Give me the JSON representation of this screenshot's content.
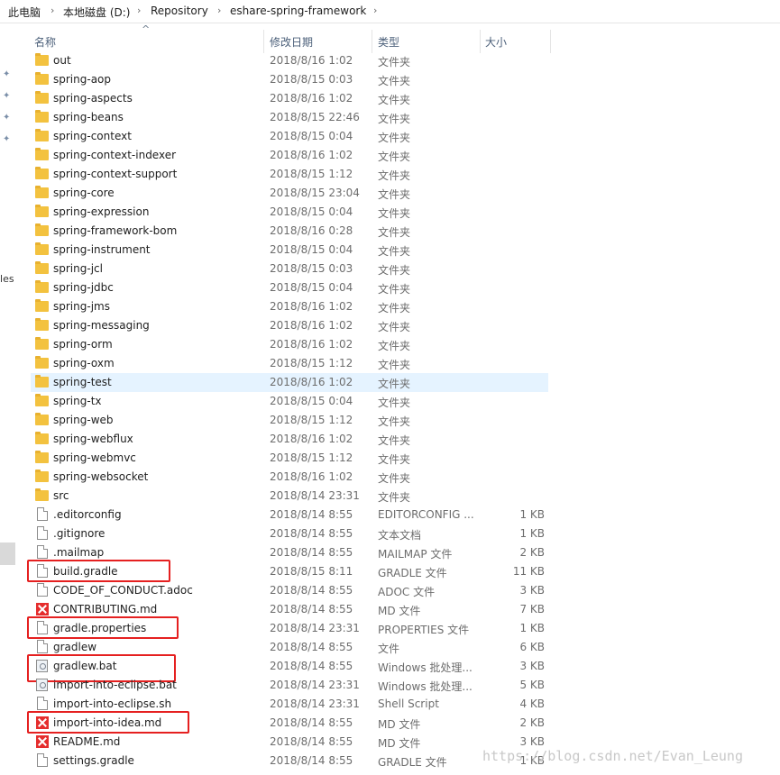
{
  "breadcrumb": [
    "此电脑",
    "本地磁盘 (D:)",
    "Repository",
    "eshare-spring-framework"
  ],
  "nav": {
    "files_label": "iles"
  },
  "columns": {
    "name": "名称",
    "date": "修改日期",
    "type": "类型",
    "size": "大小"
  },
  "files": [
    {
      "name": "out",
      "date": "2018/8/16 1:02",
      "type": "文件夹",
      "size": "",
      "icon": "folder-icon"
    },
    {
      "name": "spring-aop",
      "date": "2018/8/15 0:03",
      "type": "文件夹",
      "size": "",
      "icon": "folder-icon"
    },
    {
      "name": "spring-aspects",
      "date": "2018/8/16 1:02",
      "type": "文件夹",
      "size": "",
      "icon": "folder-icon"
    },
    {
      "name": "spring-beans",
      "date": "2018/8/15 22:46",
      "type": "文件夹",
      "size": "",
      "icon": "folder-icon"
    },
    {
      "name": "spring-context",
      "date": "2018/8/15 0:04",
      "type": "文件夹",
      "size": "",
      "icon": "folder-icon"
    },
    {
      "name": "spring-context-indexer",
      "date": "2018/8/16 1:02",
      "type": "文件夹",
      "size": "",
      "icon": "folder-icon"
    },
    {
      "name": "spring-context-support",
      "date": "2018/8/15 1:12",
      "type": "文件夹",
      "size": "",
      "icon": "folder-icon"
    },
    {
      "name": "spring-core",
      "date": "2018/8/15 23:04",
      "type": "文件夹",
      "size": "",
      "icon": "folder-icon"
    },
    {
      "name": "spring-expression",
      "date": "2018/8/15 0:04",
      "type": "文件夹",
      "size": "",
      "icon": "folder-icon"
    },
    {
      "name": "spring-framework-bom",
      "date": "2018/8/16 0:28",
      "type": "文件夹",
      "size": "",
      "icon": "folder-icon"
    },
    {
      "name": "spring-instrument",
      "date": "2018/8/15 0:04",
      "type": "文件夹",
      "size": "",
      "icon": "folder-icon"
    },
    {
      "name": "spring-jcl",
      "date": "2018/8/15 0:03",
      "type": "文件夹",
      "size": "",
      "icon": "folder-icon"
    },
    {
      "name": "spring-jdbc",
      "date": "2018/8/15 0:04",
      "type": "文件夹",
      "size": "",
      "icon": "folder-icon"
    },
    {
      "name": "spring-jms",
      "date": "2018/8/16 1:02",
      "type": "文件夹",
      "size": "",
      "icon": "folder-icon"
    },
    {
      "name": "spring-messaging",
      "date": "2018/8/16 1:02",
      "type": "文件夹",
      "size": "",
      "icon": "folder-icon"
    },
    {
      "name": "spring-orm",
      "date": "2018/8/16 1:02",
      "type": "文件夹",
      "size": "",
      "icon": "folder-icon"
    },
    {
      "name": "spring-oxm",
      "date": "2018/8/15 1:12",
      "type": "文件夹",
      "size": "",
      "icon": "folder-icon"
    },
    {
      "name": "spring-test",
      "date": "2018/8/16 1:02",
      "type": "文件夹",
      "size": "",
      "icon": "folder-icon",
      "selected": true
    },
    {
      "name": "spring-tx",
      "date": "2018/8/15 0:04",
      "type": "文件夹",
      "size": "",
      "icon": "folder-icon"
    },
    {
      "name": "spring-web",
      "date": "2018/8/15 1:12",
      "type": "文件夹",
      "size": "",
      "icon": "folder-icon"
    },
    {
      "name": "spring-webflux",
      "date": "2018/8/16 1:02",
      "type": "文件夹",
      "size": "",
      "icon": "folder-icon"
    },
    {
      "name": "spring-webmvc",
      "date": "2018/8/15 1:12",
      "type": "文件夹",
      "size": "",
      "icon": "folder-icon"
    },
    {
      "name": "spring-websocket",
      "date": "2018/8/16 1:02",
      "type": "文件夹",
      "size": "",
      "icon": "folder-icon"
    },
    {
      "name": "src",
      "date": "2018/8/14 23:31",
      "type": "文件夹",
      "size": "",
      "icon": "folder-icon"
    },
    {
      "name": ".editorconfig",
      "date": "2018/8/14 8:55",
      "type": "EDITORCONFIG ...",
      "size": "1 KB",
      "icon": "file-icon"
    },
    {
      "name": ".gitignore",
      "date": "2018/8/14 8:55",
      "type": "文本文档",
      "size": "1 KB",
      "icon": "file-icon"
    },
    {
      "name": ".mailmap",
      "date": "2018/8/14 8:55",
      "type": "MAILMAP 文件",
      "size": "2 KB",
      "icon": "file-icon"
    },
    {
      "name": "build.gradle",
      "date": "2018/8/15 8:11",
      "type": "GRADLE 文件",
      "size": "11 KB",
      "icon": "file-icon",
      "highlighted": true
    },
    {
      "name": "CODE_OF_CONDUCT.adoc",
      "date": "2018/8/14 8:55",
      "type": "ADOC 文件",
      "size": "3 KB",
      "icon": "file-icon"
    },
    {
      "name": "CONTRIBUTING.md",
      "date": "2018/8/14 8:55",
      "type": "MD 文件",
      "size": "7 KB",
      "icon": "markdown-icon"
    },
    {
      "name": "gradle.properties",
      "date": "2018/8/14 23:31",
      "type": "PROPERTIES 文件",
      "size": "1 KB",
      "icon": "file-icon",
      "highlighted": true
    },
    {
      "name": "gradlew",
      "date": "2018/8/14 8:55",
      "type": "文件",
      "size": "6 KB",
      "icon": "file-icon"
    },
    {
      "name": "gradlew.bat",
      "date": "2018/8/14 8:55",
      "type": "Windows 批处理...",
      "size": "3 KB",
      "icon": "batch-file-icon",
      "highlighted": true
    },
    {
      "name": "import-into-eclipse.bat",
      "date": "2018/8/14 23:31",
      "type": "Windows 批处理...",
      "size": "5 KB",
      "icon": "batch-file-icon"
    },
    {
      "name": "import-into-eclipse.sh",
      "date": "2018/8/14 23:31",
      "type": "Shell Script",
      "size": "4 KB",
      "icon": "file-icon"
    },
    {
      "name": "import-into-idea.md",
      "date": "2018/8/14 8:55",
      "type": "MD 文件",
      "size": "2 KB",
      "icon": "markdown-icon",
      "highlighted": true
    },
    {
      "name": "README.md",
      "date": "2018/8/14 8:55",
      "type": "MD 文件",
      "size": "3 KB",
      "icon": "markdown-icon"
    },
    {
      "name": "settings.gradle",
      "date": "2018/8/14 8:55",
      "type": "GRADLE 文件",
      "size": "1 KB",
      "icon": "file-icon"
    }
  ],
  "watermark": "https://blog.csdn.net/Evan_Leung",
  "colors": {
    "highlight": "#e52020",
    "selected_row": "#e5f3ff",
    "folder": "#f3c23f",
    "header_text": "#4c607a"
  }
}
